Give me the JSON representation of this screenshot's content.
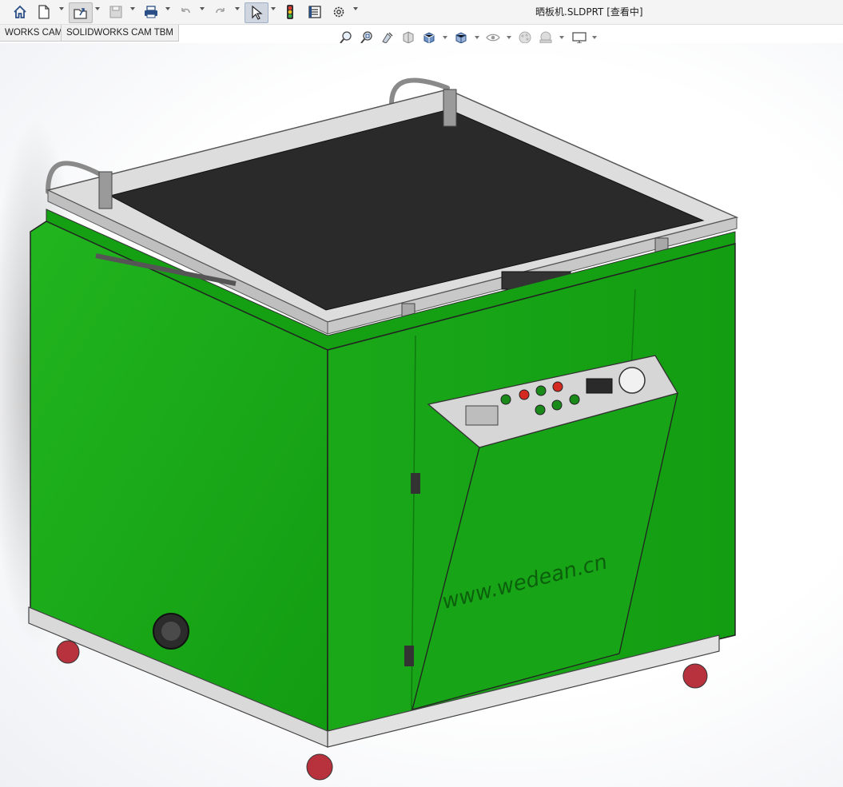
{
  "window": {
    "title": "晒板机.SLDPRT [查看中]"
  },
  "toolbar": {
    "icons": [
      "home-icon",
      "new-document-icon",
      "open-file-icon",
      "save-icon",
      "print-icon",
      "undo-icon",
      "redo-icon",
      "select-pointer-icon",
      "traffic-light-icon",
      "properties-icon",
      "settings-gear-icon"
    ]
  },
  "tabs": [
    {
      "label": "WORKS CAM"
    },
    {
      "label": "SOLIDWORKS CAM TBM"
    }
  ],
  "view_toolbar": {
    "icons": [
      "zoom-to-fit-icon",
      "zoom-area-icon",
      "previous-view-icon",
      "section-view-icon",
      "view-orientation-icon",
      "display-style-icon",
      "hide-show-icon",
      "edit-appearance-icon",
      "scene-icon",
      "view-settings-icon"
    ]
  },
  "model": {
    "watermark": "www.wedean.cn",
    "colors": {
      "body_green": "#17a516",
      "body_green_dark": "#108a10",
      "frame_gray": "#e8e8e8",
      "glass_top": "#2c2c2c",
      "panel_gray": "#d4d4d4"
    }
  }
}
